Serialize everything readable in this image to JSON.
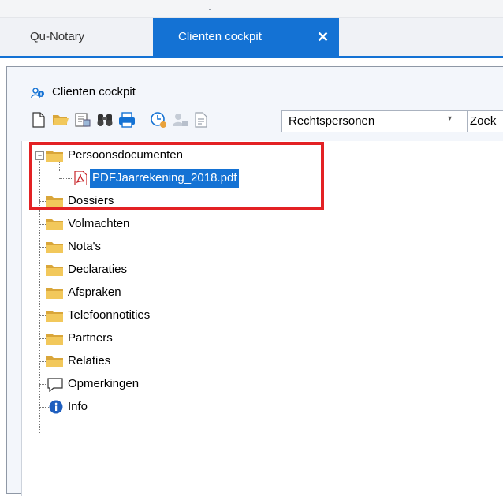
{
  "tabs": [
    {
      "label": "Qu-Notary"
    },
    {
      "label": "Clienten cockpit",
      "close": "✕"
    }
  ],
  "panel": {
    "title": "Clienten cockpit"
  },
  "toolbar": {
    "combo_value": "Rechtspersonen",
    "combo_arrow": "▾",
    "search_label": "Zoek"
  },
  "tree": {
    "expander_minus": "−",
    "items": [
      {
        "label": "Persoonsdocumenten",
        "icon": "folder-icon"
      },
      {
        "label": "PDFJaarrekening_2018.pdf",
        "icon": "pdf-icon"
      },
      {
        "label": "Dossiers",
        "icon": "folder-icon"
      },
      {
        "label": "Volmachten",
        "icon": "folder-icon"
      },
      {
        "label": "Nota's",
        "icon": "folder-icon"
      },
      {
        "label": "Declaraties",
        "icon": "folder-icon"
      },
      {
        "label": "Afspraken",
        "icon": "folder-icon"
      },
      {
        "label": "Telefoonnotities",
        "icon": "folder-icon"
      },
      {
        "label": "Partners",
        "icon": "folder-icon"
      },
      {
        "label": "Relaties",
        "icon": "folder-icon"
      },
      {
        "label": "Opmerkingen",
        "icon": "comment-icon"
      },
      {
        "label": "Info",
        "icon": "info-icon"
      }
    ]
  },
  "colors": {
    "accent": "#1472d4",
    "highlight": "#e32124",
    "folder": "#e9c46a"
  }
}
